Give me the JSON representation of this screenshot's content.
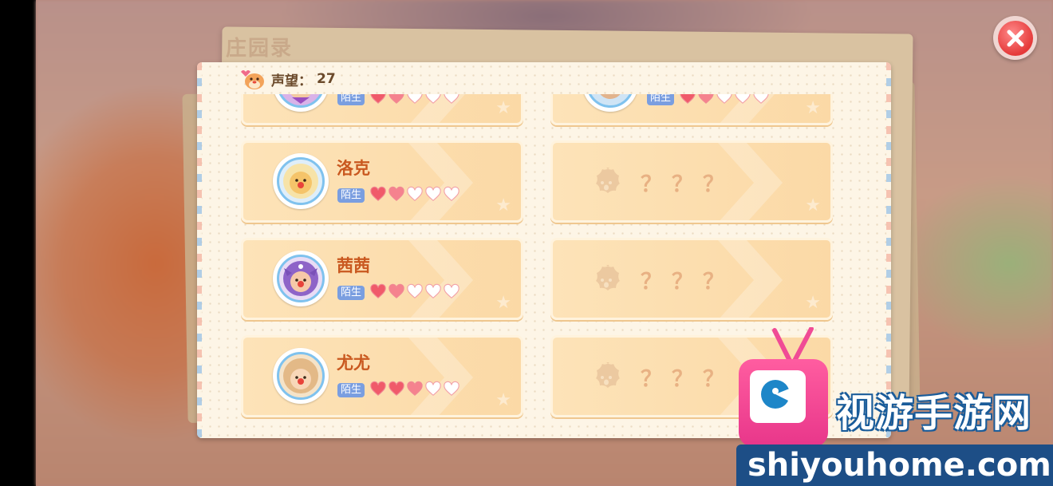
{
  "book": {
    "title": "庄园录"
  },
  "header": {
    "label": "声望：",
    "value": "27"
  },
  "close_icon": "close-icon",
  "colors": {
    "name": "#c9581f",
    "tag_bg": "#7a9ee0",
    "heart_full": "#f05a6a",
    "heart_empty": "#ffffff",
    "unknown": "#e8b183"
  },
  "characters": [
    {
      "name": "",
      "tag": "陌生",
      "hearts": "half-visible",
      "partial": true
    },
    {
      "name": "",
      "tag": "陌生",
      "partial": true
    },
    {
      "name": "洛克",
      "tag": "陌生"
    },
    {
      "name": "???",
      "unknown": true
    },
    {
      "name": "茜茜",
      "tag": "陌生"
    },
    {
      "name": "???",
      "unknown": true
    },
    {
      "name": "尤尤",
      "tag": "陌生"
    },
    {
      "name": "???",
      "unknown": true
    }
  ],
  "unknown_label": "？？？",
  "watermark": {
    "cn": "视游手游网",
    "en": "shiyouhome.com"
  }
}
